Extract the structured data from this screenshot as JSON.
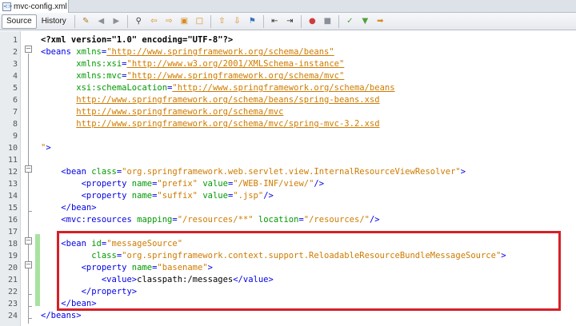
{
  "tabbar": {
    "file_name": "mvc-config.xml",
    "file_icon": "xml-file-icon"
  },
  "toolbar": {
    "source_label": "Source",
    "history_label": "History",
    "icons": [
      "last-edit-icon",
      "back-icon",
      "forward-icon",
      "find-icon",
      "find-previous-icon",
      "find-next-icon",
      "find-selection-icon",
      "toggle-highlight-icon",
      "previous-bookmark-icon",
      "next-bookmark-icon",
      "toggle-bookmark-icon",
      "shift-left-icon",
      "shift-right-icon",
      "start-macro-icon",
      "stop-macro-icon",
      "check-xml-icon",
      "validate-xml-icon",
      "xsl-transform-icon"
    ]
  },
  "editor": {
    "lines": [
      {
        "n": "1",
        "tokens": [
          [
            "decl",
            "<?xml version=\"1.0\" encoding=\"UTF-8\"?>"
          ]
        ]
      },
      {
        "n": "2",
        "tokens": [
          [
            "tag",
            "<beans "
          ],
          [
            "attr",
            "xmlns"
          ],
          [
            "punct",
            "="
          ],
          [
            "url",
            "\"http://www.springframework.org/schema/beans\""
          ]
        ]
      },
      {
        "n": "3",
        "tokens": [
          [
            "text",
            "       "
          ],
          [
            "attr",
            "xmlns:xsi"
          ],
          [
            "punct",
            "="
          ],
          [
            "url",
            "\"http://www.w3.org/2001/XMLSchema-instance\""
          ]
        ]
      },
      {
        "n": "4",
        "tokens": [
          [
            "text",
            "       "
          ],
          [
            "attr",
            "xmlns:mvc"
          ],
          [
            "punct",
            "="
          ],
          [
            "url",
            "\"http://www.springframework.org/schema/mvc\""
          ]
        ]
      },
      {
        "n": "5",
        "tokens": [
          [
            "text",
            "       "
          ],
          [
            "attr",
            "xsi:schemaLocation"
          ],
          [
            "punct",
            "="
          ],
          [
            "url",
            "\"http://www.springframework.org/schema/beans"
          ]
        ]
      },
      {
        "n": "6",
        "tokens": [
          [
            "text",
            "       "
          ],
          [
            "url",
            "http://www.springframework.org/schema/beans/spring-beans.xsd"
          ]
        ]
      },
      {
        "n": "7",
        "tokens": [
          [
            "text",
            "       "
          ],
          [
            "url",
            "http://www.springframework.org/schema/mvc"
          ]
        ]
      },
      {
        "n": "8",
        "tokens": [
          [
            "text",
            "       "
          ],
          [
            "url",
            "http://www.springframework.org/schema/mvc/spring-mvc-3.2.xsd"
          ]
        ]
      },
      {
        "n": "9",
        "tokens": []
      },
      {
        "n": "10",
        "tokens": [
          [
            "val",
            "\""
          ],
          [
            "tag",
            ">"
          ]
        ]
      },
      {
        "n": "11",
        "tokens": []
      },
      {
        "n": "12",
        "tokens": [
          [
            "text",
            "    "
          ],
          [
            "tag",
            "<bean "
          ],
          [
            "attr",
            "class"
          ],
          [
            "punct",
            "="
          ],
          [
            "val",
            "\"org.springframework.web.servlet.view.InternalResourceViewResolver\""
          ],
          [
            "tag",
            ">"
          ]
        ]
      },
      {
        "n": "13",
        "tokens": [
          [
            "text",
            "        "
          ],
          [
            "tag",
            "<property "
          ],
          [
            "attr",
            "name"
          ],
          [
            "punct",
            "="
          ],
          [
            "val",
            "\"prefix\""
          ],
          [
            "text",
            " "
          ],
          [
            "attr",
            "value"
          ],
          [
            "punct",
            "="
          ],
          [
            "val",
            "\"/WEB-INF/view/\""
          ],
          [
            "tag",
            "/>"
          ]
        ]
      },
      {
        "n": "14",
        "tokens": [
          [
            "text",
            "        "
          ],
          [
            "tag",
            "<property "
          ],
          [
            "attr",
            "name"
          ],
          [
            "punct",
            "="
          ],
          [
            "val",
            "\"suffix\""
          ],
          [
            "text",
            " "
          ],
          [
            "attr",
            "value"
          ],
          [
            "punct",
            "="
          ],
          [
            "val",
            "\".jsp\""
          ],
          [
            "tag",
            "/>"
          ]
        ]
      },
      {
        "n": "15",
        "tokens": [
          [
            "text",
            "    "
          ],
          [
            "tag",
            "</bean>"
          ]
        ]
      },
      {
        "n": "16",
        "tokens": [
          [
            "text",
            "    "
          ],
          [
            "tag",
            "<mvc:resources "
          ],
          [
            "attr",
            "mapping"
          ],
          [
            "punct",
            "="
          ],
          [
            "val",
            "\"/resources/**\""
          ],
          [
            "text",
            " "
          ],
          [
            "attr",
            "location"
          ],
          [
            "punct",
            "="
          ],
          [
            "val",
            "\"/resources/\""
          ],
          [
            "tag",
            "/>"
          ]
        ]
      },
      {
        "n": "17",
        "tokens": []
      },
      {
        "n": "18",
        "tokens": [
          [
            "text",
            "    "
          ],
          [
            "tag",
            "<bean "
          ],
          [
            "attr",
            "id"
          ],
          [
            "punct",
            "="
          ],
          [
            "val",
            "\"messageSource\""
          ]
        ]
      },
      {
        "n": "19",
        "tokens": [
          [
            "text",
            "          "
          ],
          [
            "attr",
            "class"
          ],
          [
            "punct",
            "="
          ],
          [
            "val",
            "\"org.springframework.context.support.ReloadableResourceBundleMessageSource\""
          ],
          [
            "tag",
            ">"
          ]
        ]
      },
      {
        "n": "20",
        "tokens": [
          [
            "text",
            "        "
          ],
          [
            "tag",
            "<property "
          ],
          [
            "attr",
            "name"
          ],
          [
            "punct",
            "="
          ],
          [
            "val",
            "\"basename\""
          ],
          [
            "tag",
            ">"
          ]
        ]
      },
      {
        "n": "21",
        "tokens": [
          [
            "text",
            "            "
          ],
          [
            "tag",
            "<value>"
          ],
          [
            "text",
            "classpath:/messages"
          ],
          [
            "tag",
            "</value>"
          ]
        ]
      },
      {
        "n": "22",
        "tokens": [
          [
            "text",
            "        "
          ],
          [
            "tag",
            "</property>"
          ]
        ]
      },
      {
        "n": "23",
        "tokens": [
          [
            "text",
            "    "
          ],
          [
            "tag",
            "</bean>"
          ]
        ]
      },
      {
        "n": "24",
        "tokens": [
          [
            "tag",
            "</beans>"
          ]
        ]
      }
    ]
  },
  "colors": {
    "highlight_border": "#d62027",
    "change_bar": "#a6e3a0",
    "tag": "#0000e6",
    "attribute": "#009900",
    "value": "#ce7b00"
  }
}
